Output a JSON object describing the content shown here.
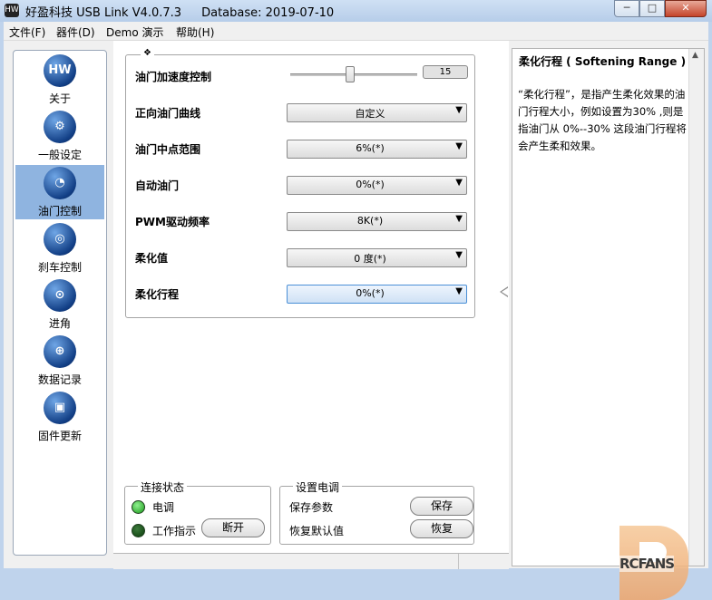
{
  "window": {
    "app_icon": "hw-logo-icon",
    "title": "好盈科技 USB Link V4.0.7.3",
    "database": "Database: 2019-07-10",
    "buttons": {
      "minimize": "─",
      "maximize": "□",
      "close": "✕"
    }
  },
  "menu": [
    "文件(F)",
    "器件(D)",
    "Demo 演示",
    "帮助(H)"
  ],
  "nav": {
    "selected_index": 2,
    "items": [
      {
        "label": "关于",
        "icon": "hw-logo-icon"
      },
      {
        "label": "一般设定",
        "icon": "gears-icon"
      },
      {
        "label": "油门控制",
        "icon": "speedometer-icon"
      },
      {
        "label": "刹车控制",
        "icon": "brake-disc-icon"
      },
      {
        "label": "进角",
        "icon": "motor-timing-icon"
      },
      {
        "label": "数据记录",
        "icon": "globe-grid-icon"
      },
      {
        "label": "固件更新",
        "icon": "chip-icon"
      }
    ]
  },
  "settings": {
    "group_marker": "❖",
    "throttle_accel": {
      "label": "油门加速度控制",
      "value": "15",
      "slider_fraction": 0.47
    },
    "rows": [
      {
        "label": "正向油门曲线",
        "value": "自定义"
      },
      {
        "label": "油门中点范围",
        "value": "6%(*)"
      },
      {
        "label": "自动油门",
        "value": "0%(*)"
      },
      {
        "label": "PWM驱动频率",
        "value": "8K(*)"
      },
      {
        "label": "柔化值",
        "value": "0 度(*)"
      },
      {
        "label": "柔化行程",
        "value": "0%(*)"
      }
    ],
    "focused_row": 5
  },
  "connection": {
    "title": "连接状态",
    "esc_label": "电调",
    "work_label": "工作指示",
    "disconnect_button": "断开",
    "esc_led": "on",
    "work_led": "off"
  },
  "esc_settings": {
    "title": "设置电调",
    "save_label": "保存参数",
    "save_button": "保存",
    "restore_label": "恢复默认值",
    "restore_button": "恢复"
  },
  "info": {
    "title": "柔化行程 ( Softening Range )",
    "body": "“柔化行程”，是指产生柔化效果的油门行程大小，例如设置为30% ,则是指油门从 0%--30% 这段油门行程将会产生柔和效果。"
  },
  "watermark": {
    "text": "RCFANS"
  }
}
